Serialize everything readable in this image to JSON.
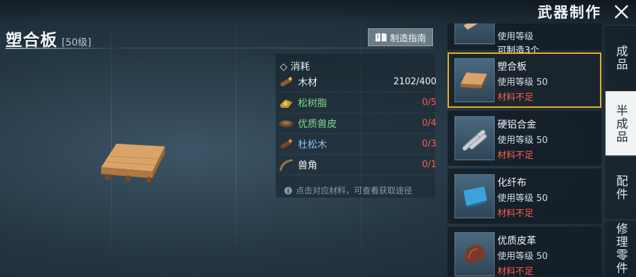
{
  "window": {
    "title": "武器制作"
  },
  "item": {
    "name": "塑合板",
    "level": "[50级]"
  },
  "guide_button": {
    "label": "制造指南"
  },
  "materials": {
    "title": "消耗",
    "rows": [
      {
        "name": "木材",
        "count": "2102/400",
        "icon": "wood-log-icon",
        "name_color": "white",
        "count_color": "white"
      },
      {
        "name": "松树脂",
        "count": "0/5",
        "icon": "resin-icon",
        "name_color": "green",
        "count_color": "red"
      },
      {
        "name": "优质兽皮",
        "count": "0/4",
        "icon": "hide-icon",
        "name_color": "green",
        "count_color": "red"
      },
      {
        "name": "杜松木",
        "count": "0/3",
        "icon": "juniper-wood-icon",
        "name_color": "blue",
        "count_color": "red"
      },
      {
        "name": "兽角",
        "count": "0/1",
        "icon": "horn-icon",
        "name_color": "white",
        "count_color": "red"
      }
    ],
    "hint": "点击对应材料，可查看获取途径"
  },
  "recipe_list": {
    "partial_top": {
      "level": "使用等级",
      "status": "可制造3个"
    },
    "cards": [
      {
        "name": "塑合板",
        "level": "使用等级 50",
        "status": "材料不足",
        "icon": "plywood-icon",
        "selected": true
      },
      {
        "name": "硬铝合金",
        "level": "使用等级 50",
        "status": "材料不足",
        "icon": "metal-rods-icon",
        "selected": false
      },
      {
        "name": "化纤布",
        "level": "使用等级 50",
        "status": "材料不足",
        "icon": "fabric-icon",
        "selected": false
      },
      {
        "name": "优质皮革",
        "level": "使用等级 50",
        "status": "材料不足",
        "icon": "leather-icon",
        "selected": false
      }
    ]
  },
  "side_tabs": [
    {
      "label": "成品",
      "active": false
    },
    {
      "label": "半成品",
      "active": true
    },
    {
      "label": "配件",
      "active": false
    },
    {
      "label": "修理零件",
      "active": false
    }
  ],
  "colors": {
    "accent": "#e6b224",
    "insufficient": "#ff5b4f",
    "green": "#7fd98a",
    "blue": "#8ec3ef"
  }
}
